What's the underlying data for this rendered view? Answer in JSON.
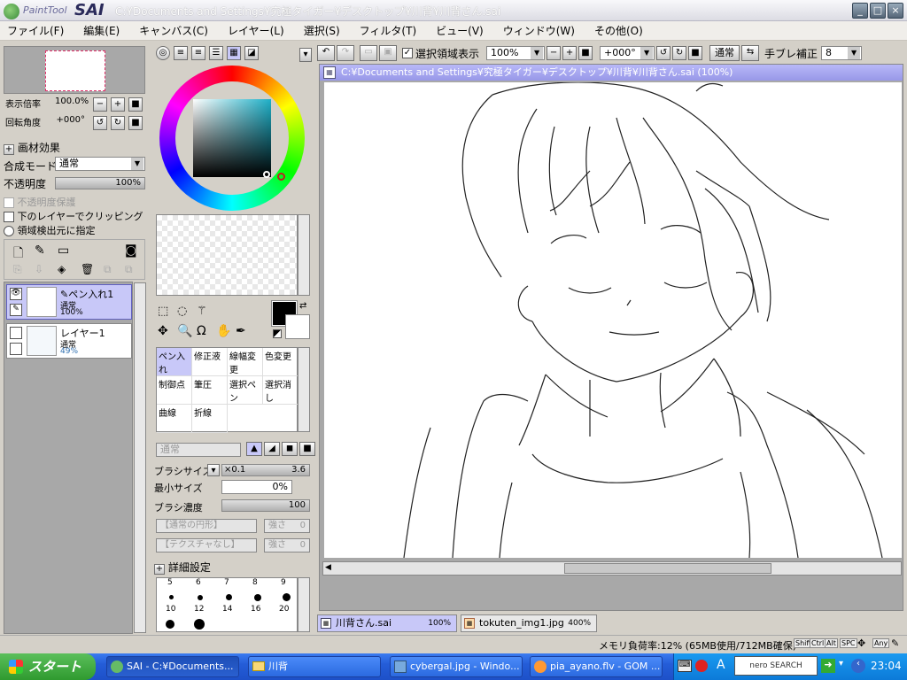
{
  "window": {
    "app_logo_text": "PaintTool",
    "app_logo_bold": "SAI",
    "title": "C:¥Documents and Settings¥究極タイガー¥デスクトップ¥川背¥川背さん.sai",
    "buttons": [
      "_",
      "□",
      "×"
    ]
  },
  "menu": [
    "ファイル(F)",
    "編集(E)",
    "キャンバス(C)",
    "レイヤー(L)",
    "選択(S)",
    "フィルタ(T)",
    "ビュー(V)",
    "ウィンドウ(W)",
    "その他(O)"
  ],
  "navigator": {
    "zoom_label": "表示倍率",
    "zoom_value": "100.0%",
    "rotate_label": "回転角度",
    "rotate_value": "+000°"
  },
  "layer_props": {
    "effect_label": "画材効果",
    "blend_label": "合成モード",
    "blend_value": "通常",
    "opacity_label": "不透明度",
    "opacity_value": "100%",
    "opacity_fraction": 1.0,
    "protect_opacity": "不透明度保護",
    "clip_lower": "下のレイヤーでクリッピング",
    "selection_source": "領域検出元に指定"
  },
  "layers": [
    {
      "name": "ペン入れ1",
      "mode": "通常",
      "opacity": "100%",
      "selected": true
    },
    {
      "name": "レイヤー1",
      "mode": "通常",
      "opacity": "49%",
      "selected": false
    }
  ],
  "color": {
    "selected_hue": "#1eb0c8",
    "foreground": "#000000",
    "background": "#ffffff"
  },
  "brushes": [
    {
      "label": "ペン入れ",
      "selected": true
    },
    {
      "label": "修正液",
      "selected": false
    },
    {
      "label": "線幅変更",
      "selected": false
    },
    {
      "label": "色変更",
      "selected": false
    },
    {
      "label": "制御点",
      "selected": false
    },
    {
      "label": "筆圧",
      "selected": false
    },
    {
      "label": "選択ペン",
      "selected": false
    },
    {
      "label": "選択消し",
      "selected": false
    },
    {
      "label": "曲線",
      "selected": false
    },
    {
      "label": "折線",
      "selected": false
    }
  ],
  "brush_settings": {
    "mode_value": "通常",
    "size_label": "ブラシサイズ",
    "size_multiplier": "×0.1",
    "size_value": "3.6",
    "min_size_label": "最小サイズ",
    "min_size_value": "0%",
    "density_label": "ブラシ濃度",
    "density_value": "100",
    "shape_value": "【通常の円形】",
    "shape_strength": "強さ",
    "shape_strength_value": "0",
    "texture_value": "【テクスチャなし】",
    "texture_strength": "強さ",
    "texture_strength_value": "0",
    "detail_label": "詳細設定",
    "sizes_row1": [
      "5",
      "6",
      "7",
      "8",
      "9"
    ],
    "sizes_row2": [
      "10",
      "12",
      "14",
      "16",
      "20"
    ]
  },
  "toolbar": {
    "show_selection_label": "選択領域表示",
    "show_selection_checked": true,
    "zoom_value": "100%",
    "angle_value": "+000°",
    "blend_button": "通常",
    "stabilizer_label": "手ブレ補正",
    "stabilizer_value": "8"
  },
  "canvas": {
    "title": "C:¥Documents and Settings¥究極タイガー¥デスクトップ¥川背¥川背さん.sai (100%)"
  },
  "doc_tabs": [
    {
      "name": "川背さん.sai",
      "zoom": "100%",
      "active": true
    },
    {
      "name": "tokuten_img1.jpg",
      "zoom": "400%",
      "active": false
    }
  ],
  "status": {
    "memory": "メモリ負荷率:12% (65MB使用/712MB確保)",
    "keys": [
      "Shift",
      "Ctrl",
      "Alt",
      "SPC",
      "Any"
    ]
  },
  "taskbar": {
    "start": "スタート",
    "items": [
      {
        "label": "SAI - C:¥Documents...",
        "active": true
      },
      {
        "label": "川背",
        "active": false
      },
      {
        "label": "cybergal.jpg - Windo...",
        "active": false
      },
      {
        "label": "pia_ayano.flv - GOM ...",
        "active": false
      }
    ],
    "ime": "A",
    "search_label": "nero SEARCH",
    "clock": "23:04"
  }
}
